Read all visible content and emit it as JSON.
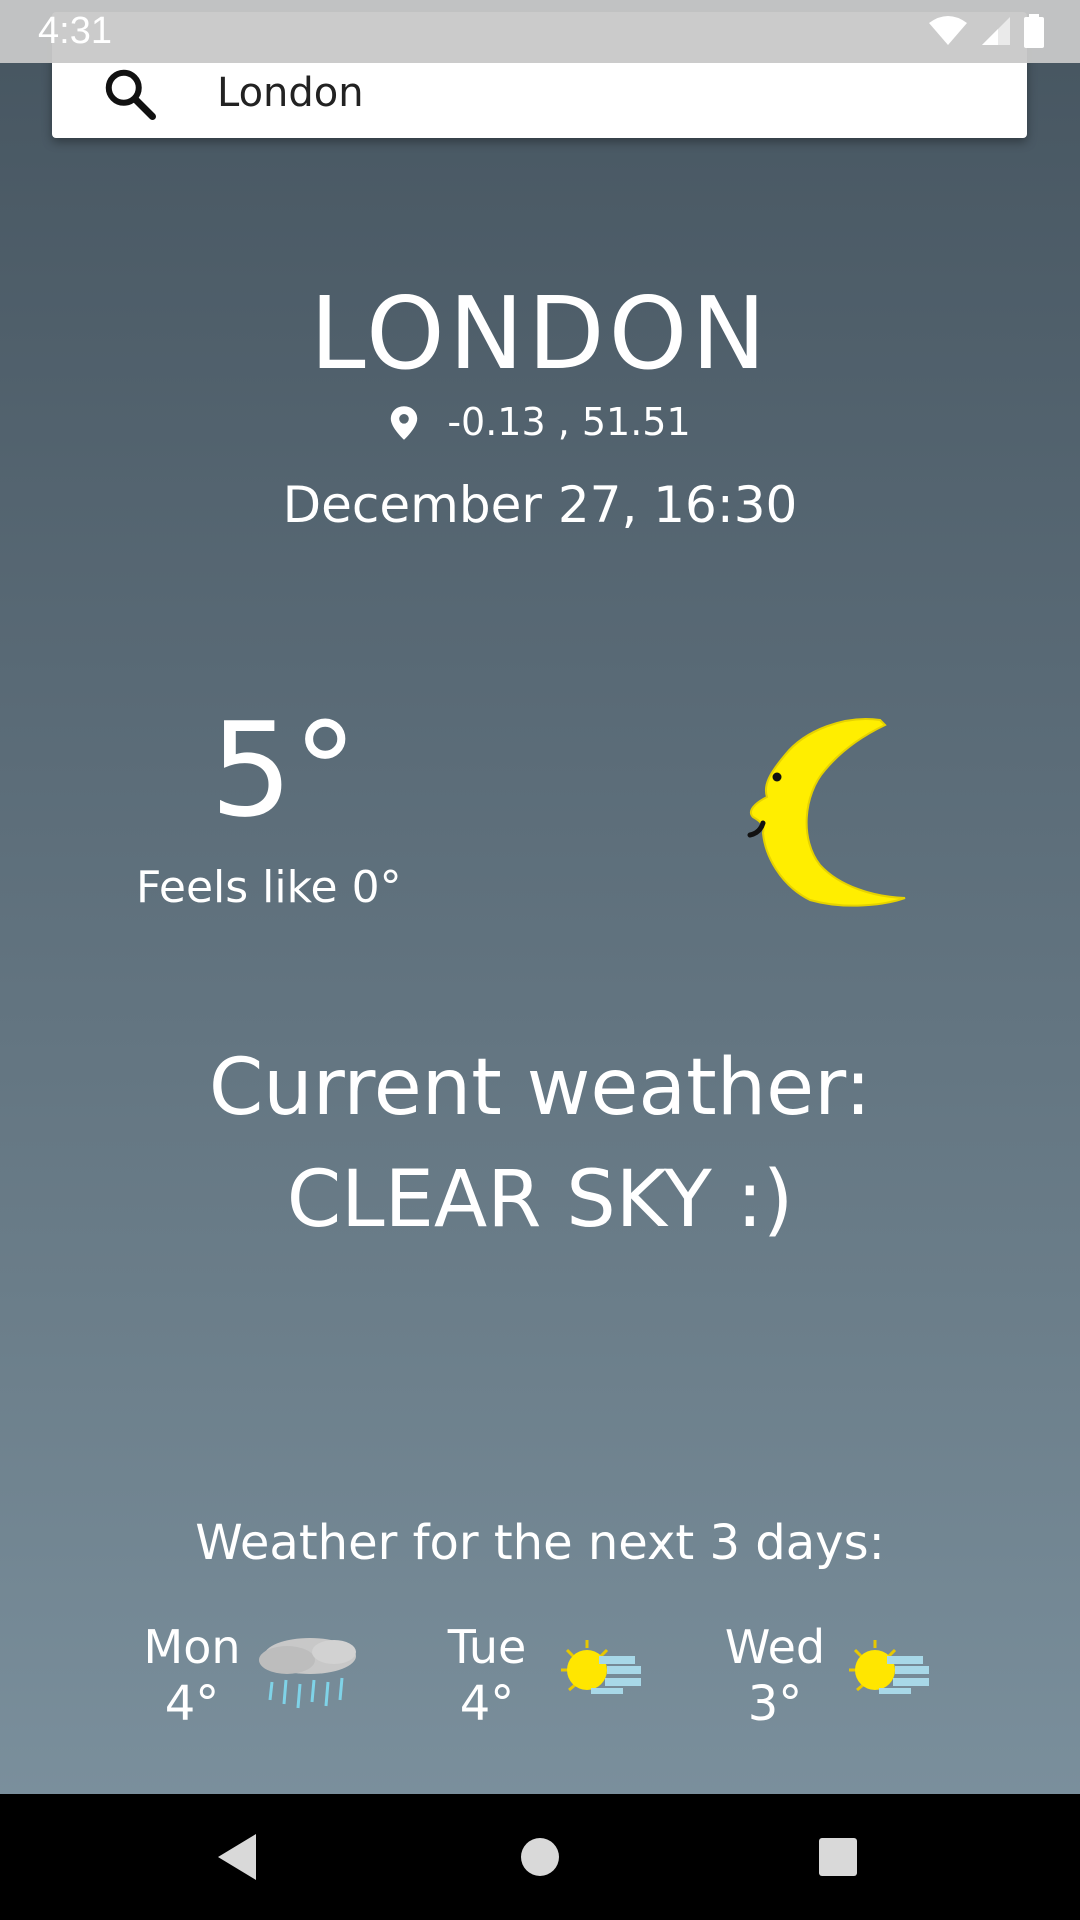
{
  "status_bar": {
    "time": "4:31",
    "icons": [
      "wifi-icon",
      "signal-icon",
      "battery-icon"
    ]
  },
  "search": {
    "value": "London",
    "icon": "search-icon"
  },
  "location": {
    "city": "LONDON",
    "coordinates": "-0.13 , 51.51",
    "datetime": "December 27, 16:30"
  },
  "current": {
    "temperature": "5°",
    "feels_like": "Feels like 0°",
    "icon": "moon-clear-night-icon",
    "label": "Current weather:",
    "condition": "CLEAR SKY :)"
  },
  "forecast": {
    "title": "Weather for the next 3 days:",
    "days": [
      {
        "day": "Mon",
        "temp": "4°",
        "icon": "rain-cloud-icon"
      },
      {
        "day": "Tue",
        "temp": "4°",
        "icon": "sun-cloud-icon"
      },
      {
        "day": "Wed",
        "temp": "3°",
        "icon": "sun-cloud-icon"
      }
    ]
  },
  "colors": {
    "background_top": "#465560",
    "background_bottom": "#7a8f9c",
    "moon": "#ffee00",
    "sun": "#ffe600",
    "rain": "#7fd3e8"
  },
  "nav": [
    "back-icon",
    "home-icon",
    "recents-icon"
  ]
}
